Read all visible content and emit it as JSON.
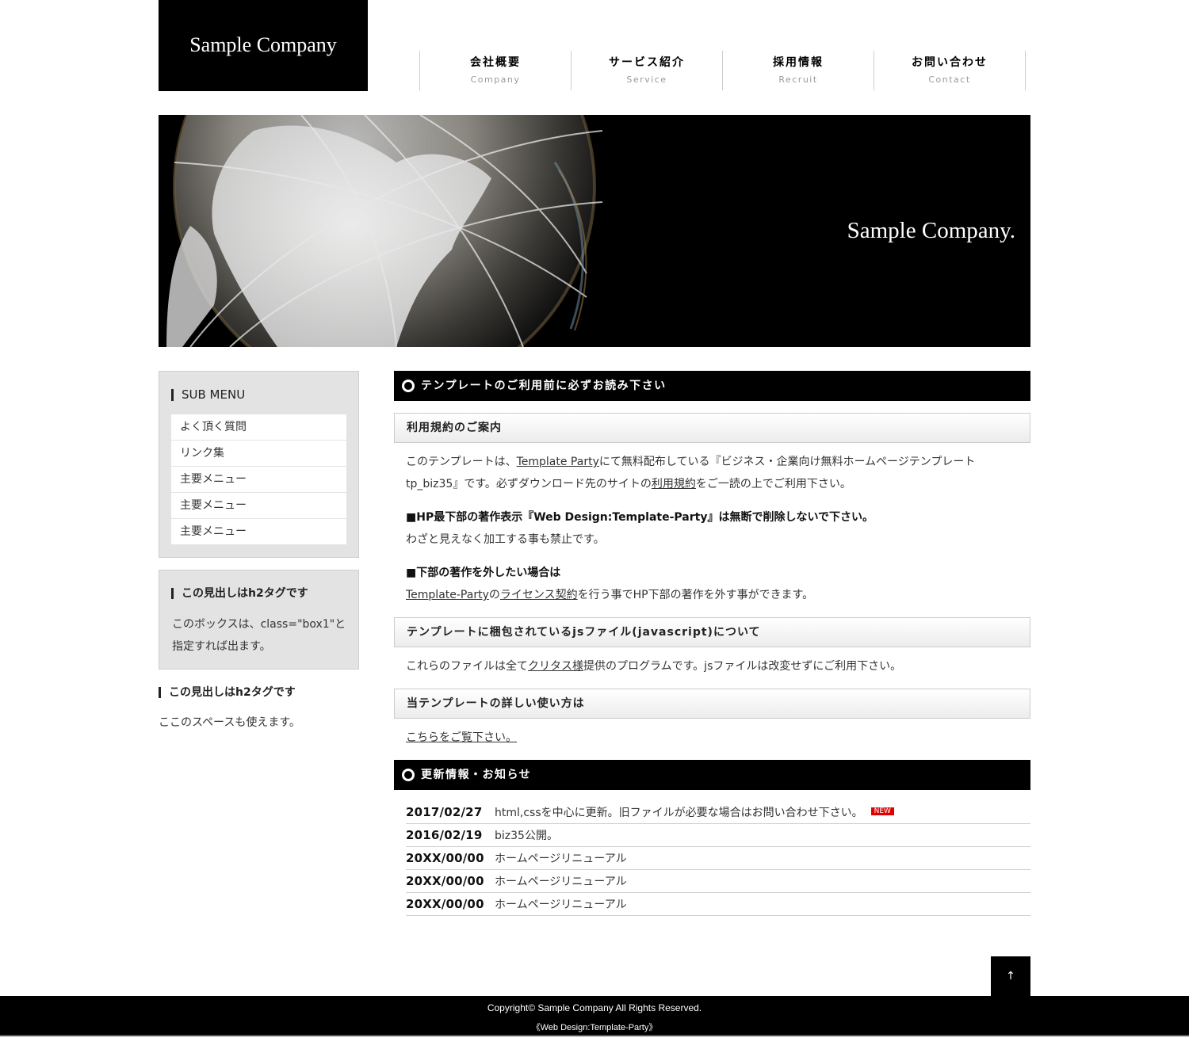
{
  "header": {
    "logo": "Sample Company",
    "nav": [
      {
        "jp": "会社概要",
        "en": "Company"
      },
      {
        "jp": "サービス紹介",
        "en": "Service"
      },
      {
        "jp": "採用情報",
        "en": "Recruit"
      },
      {
        "jp": "お問い合わせ",
        "en": "Contact"
      }
    ]
  },
  "hero": {
    "tagline": "Sample Company."
  },
  "sidebar": {
    "submenu_title": "SUB MENU",
    "submenu_items": [
      "よく頂く質問",
      "リンク集",
      "主要メニュー",
      "主要メニュー",
      "主要メニュー"
    ],
    "box1_heading": "この見出しはh2タグです",
    "box1_text": "このボックスは、class=\"box1\"と指定すれば出ます。",
    "free_heading": "この見出しはh2タグです",
    "free_text": "ここのスペースも使えます。"
  },
  "main": {
    "section1_title": "テンプレートのご利用前に必ずお読み下さい",
    "terms_title": "利用規約のご案内",
    "terms_p1_a": "このテンプレートは、",
    "terms_p1_link": "Template Party",
    "terms_p1_b": "にて無料配布している『ビジネス・企業向け無料ホームページテンプレート",
    "terms_p1_c": "tp_biz35』です。必ずダウンロード先のサイトの",
    "terms_p1_link2": "利用規約",
    "terms_p1_d": "をご一読の上でご利用下さい。",
    "notice1_bold": "■HP最下部の著作表示『Web Design:Template-Party』は無断で削除しないで下さい。",
    "notice1_text": "わざと見えなく加工する事も禁止です。",
    "notice2_bold": "■下部の著作を外したい場合は",
    "notice2_link1": "Template-Party",
    "notice2_mid": "の",
    "notice2_link2": "ライセンス契約",
    "notice2_end": "を行う事でHP下部の著作を外す事ができます。",
    "js_title": "テンプレートに梱包されているjsファイル(javascript)について",
    "js_a": "これらのファイルは全て",
    "js_link": "クリタス様",
    "js_b": "提供のプログラムです。jsファイルは改変せずにご利用下さい。",
    "usage_title": "当テンプレートの詳しい使い方は",
    "usage_link": "こちらをご覧下さい。",
    "section2_title": "更新情報・お知らせ",
    "news": [
      {
        "date": "2017/02/27",
        "text": "html,cssを中心に更新。旧ファイルが必要な場合はお問い合わせ下さい。",
        "badge": "NEW"
      },
      {
        "date": "2016/02/19",
        "text": "biz35公開。",
        "badge": ""
      },
      {
        "date": "20XX/00/00",
        "text": "ホームページリニューアル",
        "badge": ""
      },
      {
        "date": "20XX/00/00",
        "text": "ホームページリニューアル",
        "badge": ""
      },
      {
        "date": "20XX/00/00",
        "text": "ホームページリニューアル",
        "badge": ""
      }
    ]
  },
  "footer": {
    "pagetop": "↑",
    "copyright": "Copyright© Sample Company All Rights Reserved.",
    "credit": "《Web Design:Template-Party》"
  }
}
